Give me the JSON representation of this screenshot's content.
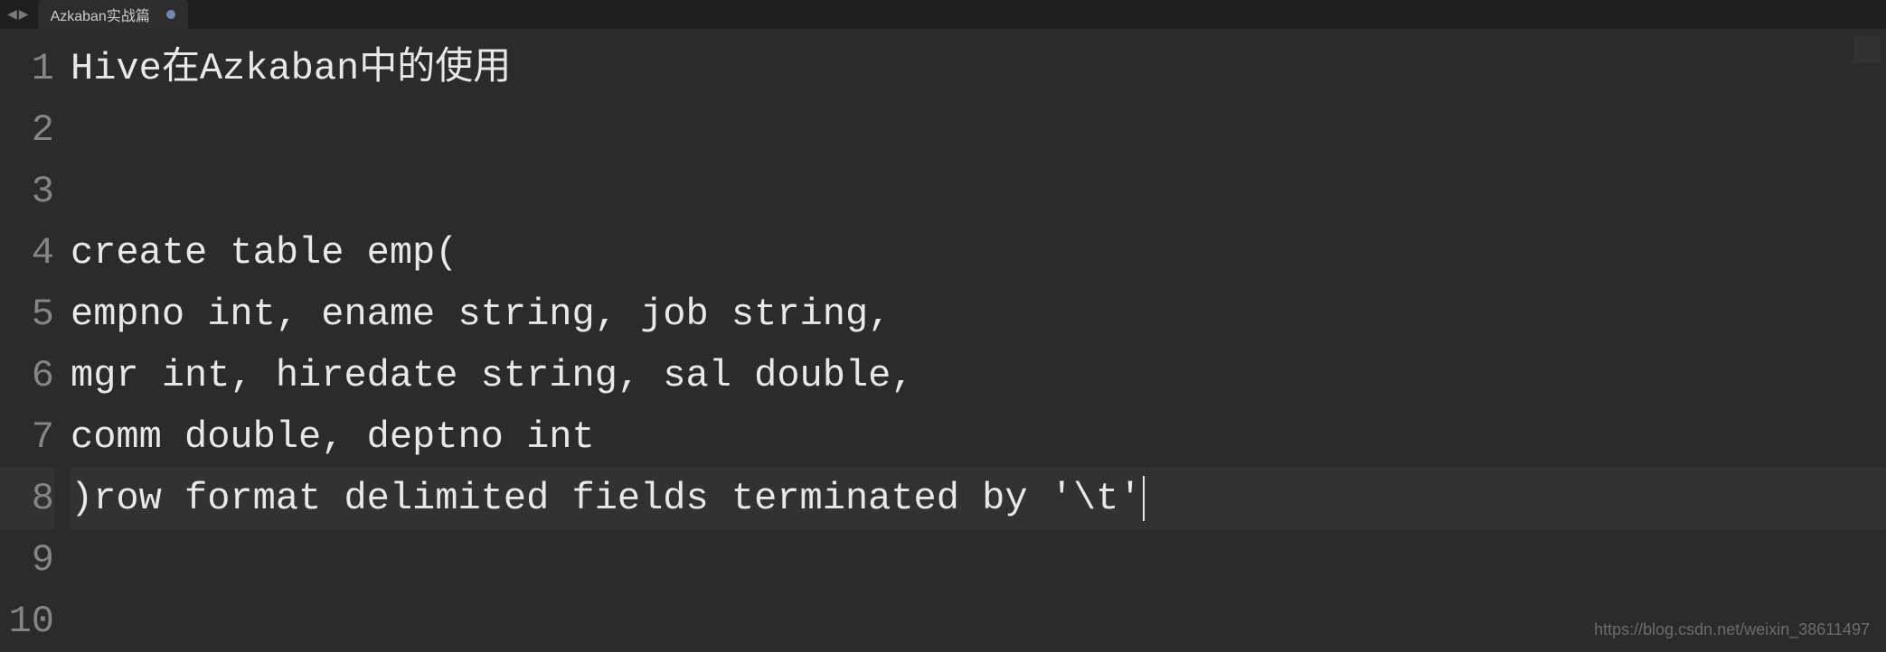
{
  "tab": {
    "title": "Azkaban实战篇",
    "modified": true
  },
  "editor": {
    "currentLine": 8,
    "lines": [
      {
        "num": 1,
        "text": "Hive在Azkaban中的使用"
      },
      {
        "num": 2,
        "text": ""
      },
      {
        "num": 3,
        "text": ""
      },
      {
        "num": 4,
        "text": "create table emp("
      },
      {
        "num": 5,
        "text": "empno int, ename string, job string,"
      },
      {
        "num": 6,
        "text": "mgr int, hiredate string, sal double,"
      },
      {
        "num": 7,
        "text": "comm double, deptno int"
      },
      {
        "num": 8,
        "text": ")row format delimited fields terminated by '\\t'"
      },
      {
        "num": 9,
        "text": ""
      },
      {
        "num": 10,
        "text": ""
      }
    ]
  },
  "watermark": "https://blog.csdn.net/weixin_38611497"
}
